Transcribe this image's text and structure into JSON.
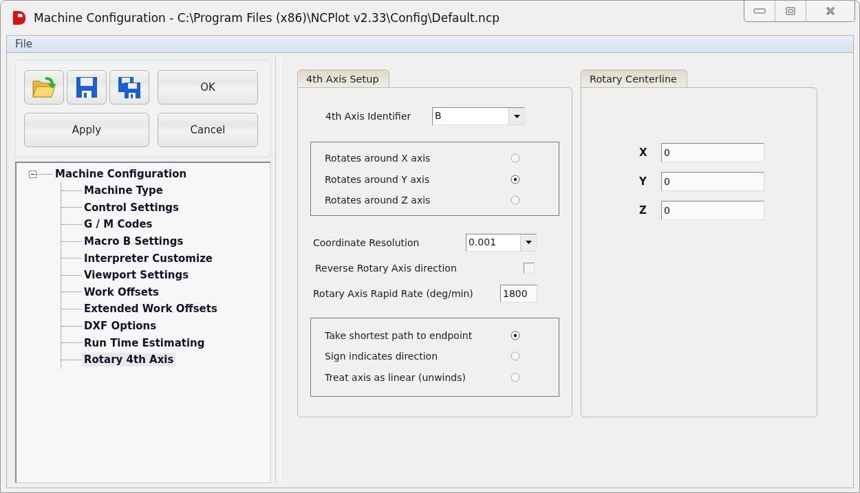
{
  "window": {
    "title": "Machine Configuration - C:\\Program Files (x86)\\NCPlot v2.33\\Config\\Default.ncp"
  },
  "menu": [
    "File"
  ],
  "buttons": [
    "OK",
    "Apply",
    "Cancel"
  ],
  "tree": {
    "label": "Machine Configuration",
    "expanded": true,
    "selected": false,
    "children": [
      {
        "label": "Machine Type",
        "selected": false
      },
      {
        "label": "Control Settings",
        "selected": false
      },
      {
        "label": "G / M Codes",
        "selected": false
      },
      {
        "label": "Macro B Settings",
        "selected": false
      },
      {
        "label": "Interpreter Customize",
        "selected": false
      },
      {
        "label": "Viewport Settings",
        "selected": false
      },
      {
        "label": "Work Offsets",
        "selected": false
      },
      {
        "label": "Extended Work Offsets",
        "selected": false
      },
      {
        "label": "DXF Options",
        "selected": false
      },
      {
        "label": "Run Time Estimating",
        "selected": false
      },
      {
        "label": "Rotary 4th Axis",
        "selected": true
      }
    ]
  },
  "setup": {
    "tab": "4th Axis Setup",
    "identifier": {
      "label": "4th Axis Identifier",
      "value": "B"
    },
    "rotation_options": [
      {
        "label": "Rotates around X axis",
        "selected": false
      },
      {
        "label": "Rotates around Y axis",
        "selected": true
      },
      {
        "label": "Rotates around Z axis",
        "selected": false
      }
    ],
    "resolution": {
      "label": "Coordinate Resolution",
      "value": "0.001"
    },
    "reverse": {
      "label": "Reverse Rotary Axis direction",
      "checked": false
    },
    "rapid_rate": {
      "label": "Rotary Axis Rapid Rate (deg/min)",
      "value": "1800"
    },
    "path_options": [
      {
        "label": "Take shortest path to endpoint",
        "selected": true
      },
      {
        "label": "Sign indicates direction",
        "selected": false
      },
      {
        "label": "Treat axis as linear (unwinds)",
        "selected": false
      }
    ]
  },
  "centerline": {
    "tab": "Rotary Centerline",
    "fields": [
      {
        "label": "X",
        "value": "0"
      },
      {
        "label": "Y",
        "value": "0"
      },
      {
        "label": "Z",
        "value": "0"
      }
    ]
  }
}
